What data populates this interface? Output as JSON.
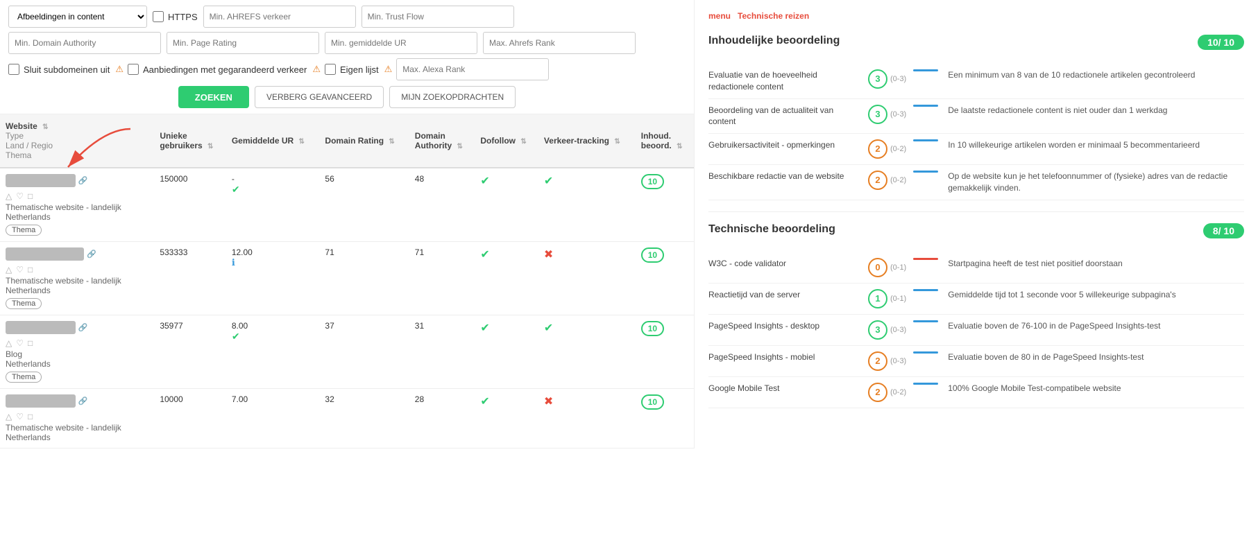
{
  "filters": {
    "row1": [
      {
        "type": "select",
        "value": "Afbeeldingen in content",
        "name": "images-filter"
      },
      {
        "type": "checkbox",
        "label": "HTTPS",
        "name": "https-filter"
      },
      {
        "type": "input",
        "placeholder": "Min. AHREFS verkeer",
        "name": "min-ahrefs"
      },
      {
        "type": "input",
        "placeholder": "Min. Trust Flow",
        "name": "min-trust-flow"
      }
    ],
    "row2": [
      {
        "type": "input",
        "placeholder": "Min. Domain Authority",
        "name": "min-da"
      },
      {
        "type": "input",
        "placeholder": "Min. Page Rating",
        "name": "min-pr"
      },
      {
        "type": "input",
        "placeholder": "Min. gemiddelde UR",
        "name": "min-ur"
      },
      {
        "type": "input",
        "placeholder": "Max. Ahrefs Rank",
        "name": "max-ahrefs-rank"
      }
    ],
    "row3": [
      {
        "type": "checkbox",
        "label": "Sluit subdomeinen uit",
        "name": "exclude-sub"
      },
      {
        "type": "checkbox",
        "label": "Aanbiedingen met gegarandeerd verkeer",
        "name": "guaranteed-traffic"
      },
      {
        "type": "checkbox-warn",
        "label": "Eigen lijst",
        "name": "own-list"
      },
      {
        "type": "input-warn",
        "placeholder": "Max. Alexa Rank",
        "name": "max-alexa"
      }
    ]
  },
  "buttons": {
    "search": "ZOEKEN",
    "hide_advanced": "VERBERG GEAVANCEERD",
    "my_searches": "MIJN ZOEKOPDRACHTEN"
  },
  "table": {
    "columns": [
      "Website\nType\nLand / Regio\nThema",
      "Unieke gebruikers",
      "Gemiddelde UR",
      "Domain Rating",
      "Domain Authority",
      "Dofollow",
      "Verkeer-tracking",
      "Inhoud. beoord."
    ],
    "rows": [
      {
        "name": "████████.nl",
        "type": "Thematische website - landelijk",
        "country": "Netherlands",
        "theme": "Thema",
        "unique_users": "150000",
        "avg_ur": "-",
        "domain_rating": "56",
        "domain_authority": "48",
        "dofollow": "check",
        "traffic_tracking": "check",
        "score": "10",
        "score_extra": "check"
      },
      {
        "name": "████████.info",
        "type": "Thematische website - landelijk",
        "country": "Netherlands",
        "theme": "Thema",
        "unique_users": "533333",
        "avg_ur": "12.00",
        "domain_rating": "71",
        "domain_authority": "71",
        "dofollow": "check",
        "traffic_tracking": "cross",
        "score": "10",
        "score_extra": "info"
      },
      {
        "name": "████████.nl",
        "type": "Blog",
        "country": "Netherlands",
        "theme": "Thema",
        "unique_users": "35977",
        "avg_ur": "8.00",
        "domain_rating": "37",
        "domain_authority": "31",
        "dofollow": "check",
        "traffic_tracking": "check",
        "score": "10",
        "score_extra": "check"
      },
      {
        "name": "████████.nl",
        "type": "Thematische website - landelijk",
        "country": "Netherlands",
        "theme": "",
        "unique_users": "10000",
        "avg_ur": "7.00",
        "domain_rating": "32",
        "domain_authority": "28",
        "dofollow": "check",
        "traffic_tracking": "cross",
        "score": "10",
        "score_extra": ""
      }
    ]
  },
  "right_panel": {
    "top_label": "menu",
    "top_link": "Technische reizen",
    "inhoudelijke": {
      "title": "Inhoudelijke beoordeling",
      "score": "10/ 10",
      "criteria": [
        {
          "label": "Evaluatie van de hoeveelheid redactionele content",
          "score": "3",
          "range": "(0-3)",
          "desc": "Een minimum van 8 van de 10 redactionele artikelen gecontroleerd"
        },
        {
          "label": "Beoordeling van de actualiteit van content",
          "score": "3",
          "range": "(0-3)",
          "desc": "De laatste redactionele content is niet ouder dan 1 werkdag"
        },
        {
          "label": "Gebruikersactiviteit - opmerkingen",
          "score": "2",
          "range": "(0-2)",
          "score_color": "amber",
          "desc": "In 10 willekeurige artikelen worden er minimaal 5 becommentarieerd"
        },
        {
          "label": "Beschikbare redactie van de website",
          "score": "2",
          "range": "(0-2)",
          "score_color": "amber",
          "desc": "Op de website kun je het telefoonnummer of (fysieke) adres van de redactie gemakkelijk vinden."
        }
      ]
    },
    "technische": {
      "title": "Technische beoordeling",
      "score": "8/ 10",
      "criteria": [
        {
          "label": "W3C - code validator",
          "score": "0",
          "range": "(0-1)",
          "score_color": "amber",
          "desc": "Startpagina heeft de test niet positief doorstaan"
        },
        {
          "label": "Reactietijd van de server",
          "score": "1",
          "range": "(0-1)",
          "desc": "Gemiddelde tijd tot 1 seconde voor 5 willekeurige subpagina's"
        },
        {
          "label": "PageSpeed Insights - desktop",
          "score": "3",
          "range": "(0-3)",
          "desc": "Evaluatie boven de 76-100 in de PageSpeed Insights-test"
        },
        {
          "label": "PageSpeed Insights - mobiel",
          "score": "2",
          "range": "(0-3)",
          "score_color": "amber",
          "desc": "Evaluatie boven de 80 in de PageSpeed Insights-test"
        },
        {
          "label": "Google Mobile Test",
          "score": "2",
          "range": "(0-2)",
          "desc": "100% Google Mobile Test-compatibele website"
        }
      ]
    }
  }
}
